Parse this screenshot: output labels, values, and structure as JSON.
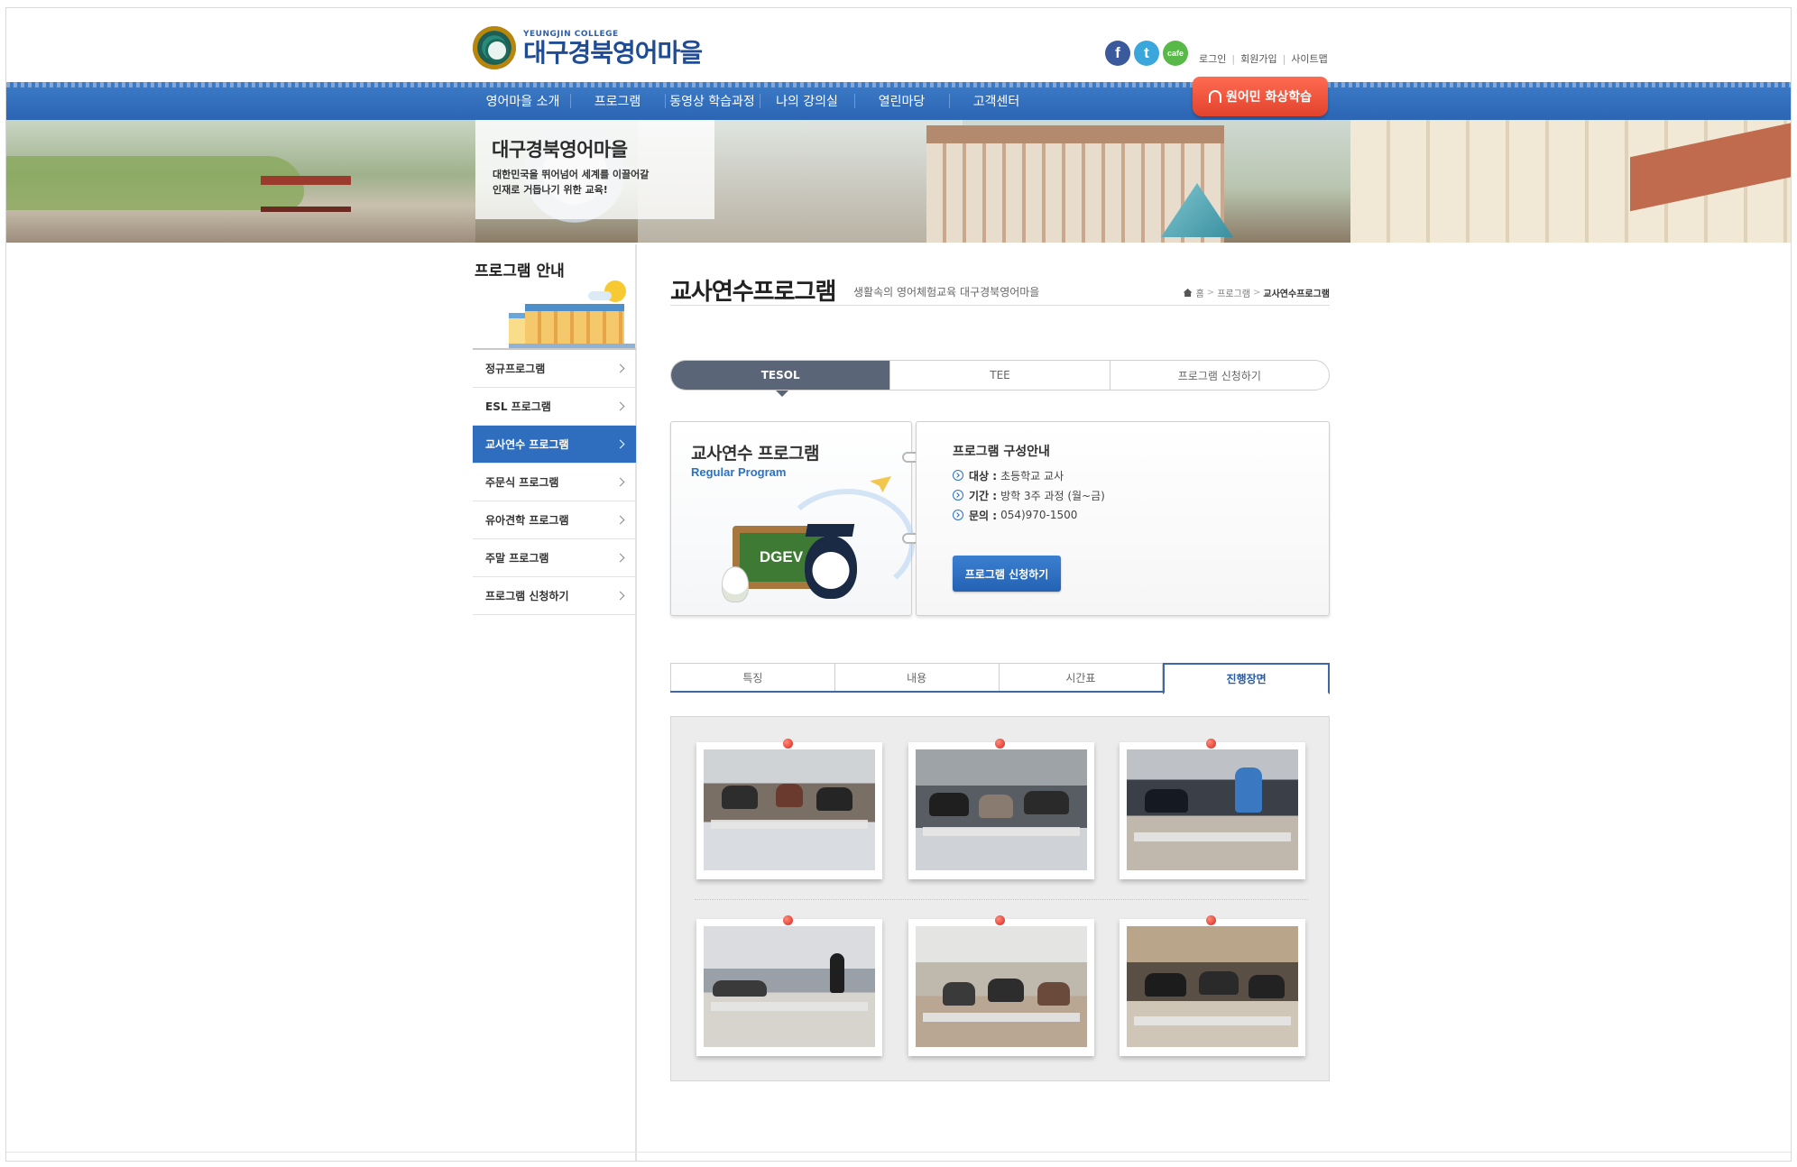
{
  "header": {
    "logo_sub": "YEUNGJIN COLLEGE",
    "logo_main": "대구경북영어마을",
    "social": [
      {
        "icon": "facebook-icon",
        "glyph": "f"
      },
      {
        "icon": "twitter-icon",
        "glyph": "t"
      },
      {
        "icon": "cafe-icon",
        "glyph": "cafe"
      }
    ],
    "util_links": [
      "로그인",
      "회원가입",
      "사이트맵"
    ]
  },
  "nav": {
    "items": [
      "영어마을 소개",
      "프로그램",
      "동영상 학습과정",
      "나의 강의실",
      "열린마당",
      "고객센터"
    ],
    "special": "원어민 화상학습"
  },
  "banner": {
    "title": "대구경북영어마을",
    "desc_line1": "대한민국을 뛰어넘어 세계를 이끌어갈",
    "desc_line2": "인재로 거듭나기 위한 교육!"
  },
  "sidebar": {
    "title": "프로그램 안내",
    "items": [
      {
        "label": "정규프로그램",
        "active": false
      },
      {
        "label": "ESL 프로그램",
        "active": false
      },
      {
        "label": "교사연수 프로그램",
        "active": true
      },
      {
        "label": "주문식 프로그램",
        "active": false
      },
      {
        "label": "유아견학 프로그램",
        "active": false
      },
      {
        "label": "주말 프로그램",
        "active": false
      },
      {
        "label": "프로그램 신청하기",
        "active": false
      }
    ]
  },
  "page": {
    "title": "교사연수프로그램",
    "subtitle": "생활속의 영어체험교육 대구경북영어마을",
    "breadcrumb": [
      "홈",
      "프로그램",
      "교사연수프로그램"
    ]
  },
  "program_tabs": {
    "items": [
      "TESOL",
      "TEE",
      "프로그램 신청하기"
    ],
    "active": 0
  },
  "program_card": {
    "title": "교사연수 프로그램",
    "subtitle": "Regular Program",
    "board_text": "DGEV"
  },
  "info_card": {
    "heading": "프로그램 구성안내",
    "rows": [
      {
        "label": "대상 :",
        "value": "초등학교 교사"
      },
      {
        "label": "기간 :",
        "value": "방학 3주 과정 (월~금)"
      },
      {
        "label": "문의 :",
        "value": "054)970-1500"
      }
    ],
    "button": "프로그램 신청하기"
  },
  "detail_tabs": {
    "items": [
      "특징",
      "내용",
      "시간표",
      "진행장면"
    ],
    "active": 3
  },
  "gallery": {
    "photos": [
      "classroom-photo-1",
      "classroom-photo-2",
      "classroom-photo-3",
      "classroom-photo-4",
      "classroom-photo-5",
      "classroom-photo-6"
    ]
  },
  "colors": {
    "nav_blue": "#2b65b3",
    "accent_red": "#e2432c",
    "active_blue": "#2f6dbf",
    "tab_dark": "#5a6577"
  }
}
